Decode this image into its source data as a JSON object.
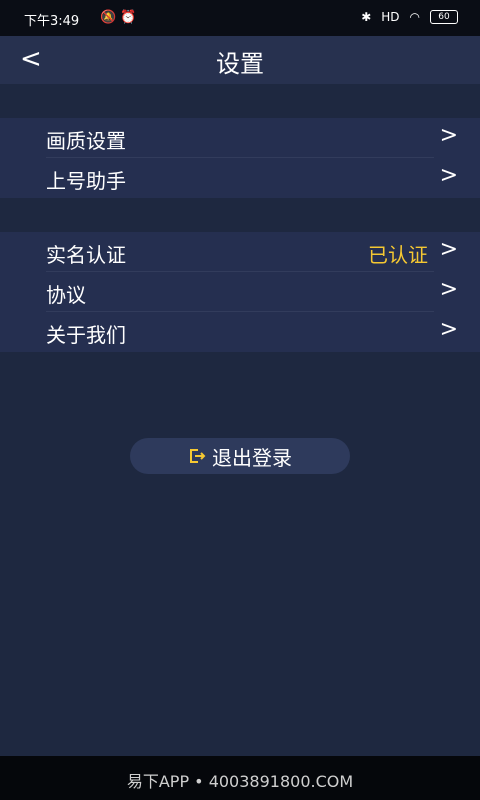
{
  "status_bar": {
    "time": "下午3:49",
    "right_text": "HD",
    "battery": "60"
  },
  "header": {
    "back_glyph": "<",
    "title": "设置"
  },
  "group1": {
    "items": [
      {
        "label": "画质设置"
      },
      {
        "label": "上号助手"
      }
    ]
  },
  "group2": {
    "items": [
      {
        "label": "实名认证",
        "status": "已认证"
      },
      {
        "label": "协议"
      },
      {
        "label": "关于我们"
      }
    ]
  },
  "chevron_glyph": ">",
  "logout": {
    "label": "退出登录",
    "icon": "logout-icon"
  },
  "footer": {
    "watermark": "易下APP • 4003891800.COM"
  },
  "colors": {
    "background": "#1e2840",
    "card": "#252f50",
    "accent": "#f5c832"
  }
}
